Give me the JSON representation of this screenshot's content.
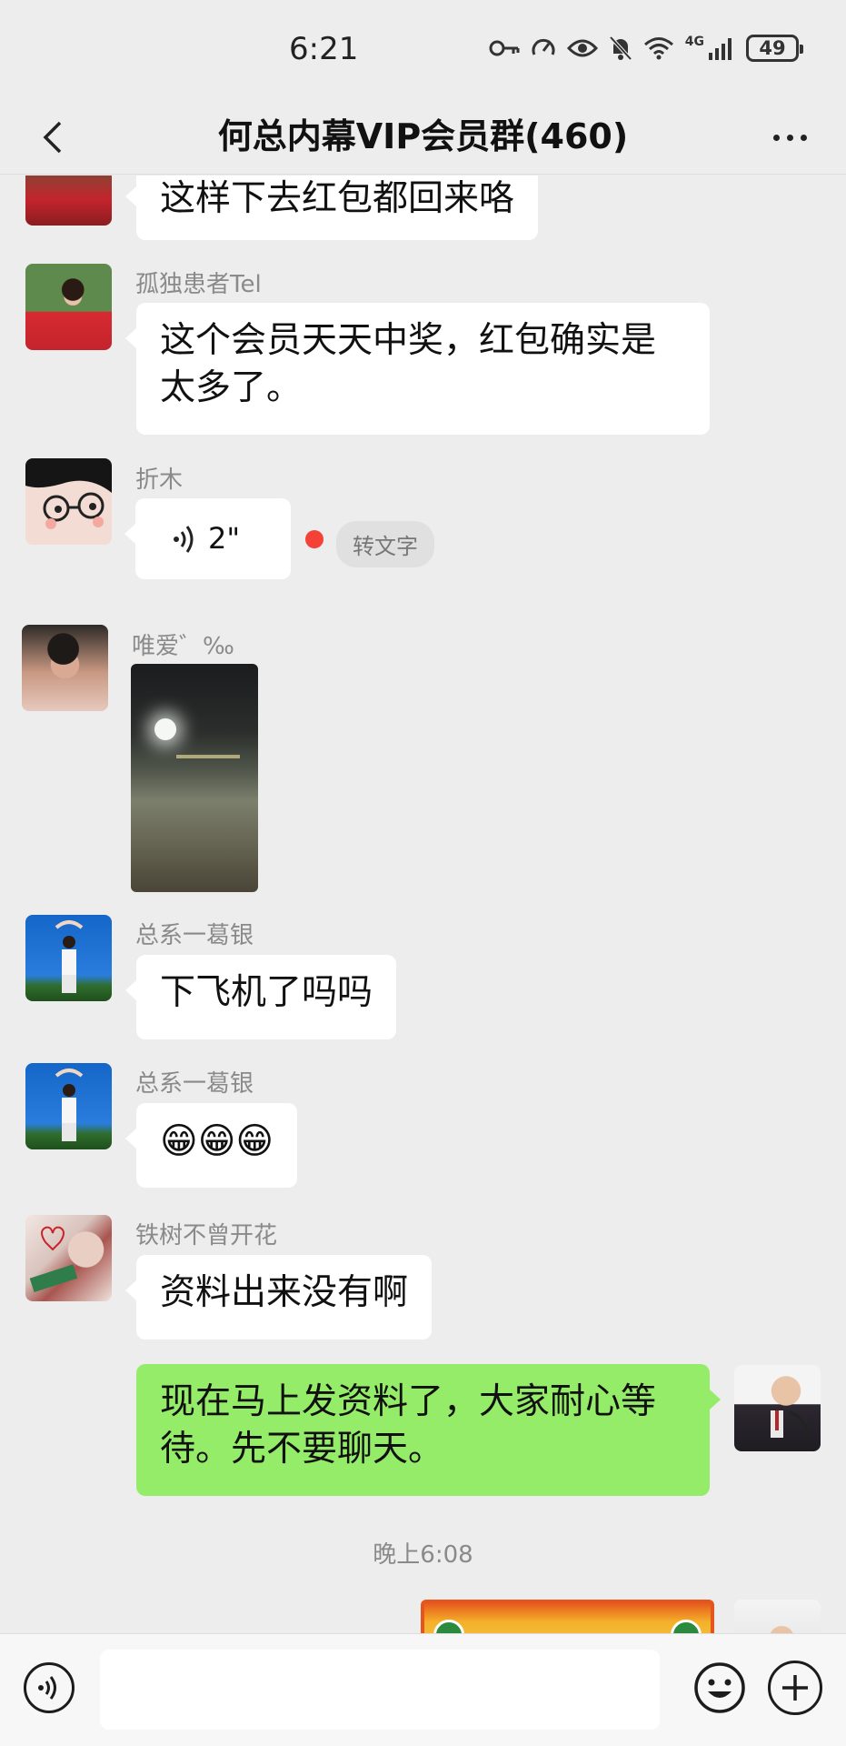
{
  "status_bar": {
    "time": "6:21",
    "network_label": "4G",
    "battery": "49"
  },
  "header": {
    "title": "何总内幕VIP会员群(460)"
  },
  "messages": [
    {
      "sender": "",
      "text": "这样下去红包都回来咯"
    },
    {
      "sender": "孤独患者Tel",
      "text": "这个会员天天中奖，红包确实是太多了。"
    },
    {
      "sender": "折木",
      "voice_duration": "2\"",
      "to_text_label": "转文字"
    },
    {
      "sender": "唯爱゛‰"
    },
    {
      "sender": "总系一葛银",
      "text": "下飞机了吗吗"
    },
    {
      "sender": "总系一葛银",
      "text": "😁😁😁"
    },
    {
      "sender": "铁树不曾开花",
      "text": "资料出来没有啊"
    },
    {
      "sender": "",
      "text": "现在马上发资料了，大家耐心等待。先不要聊天。"
    }
  ],
  "time_label": "晚上6:08",
  "colors": {
    "background": "#ededed",
    "own_bubble": "#95ec69",
    "other_bubble": "#ffffff",
    "unread_dot": "#f44336"
  }
}
